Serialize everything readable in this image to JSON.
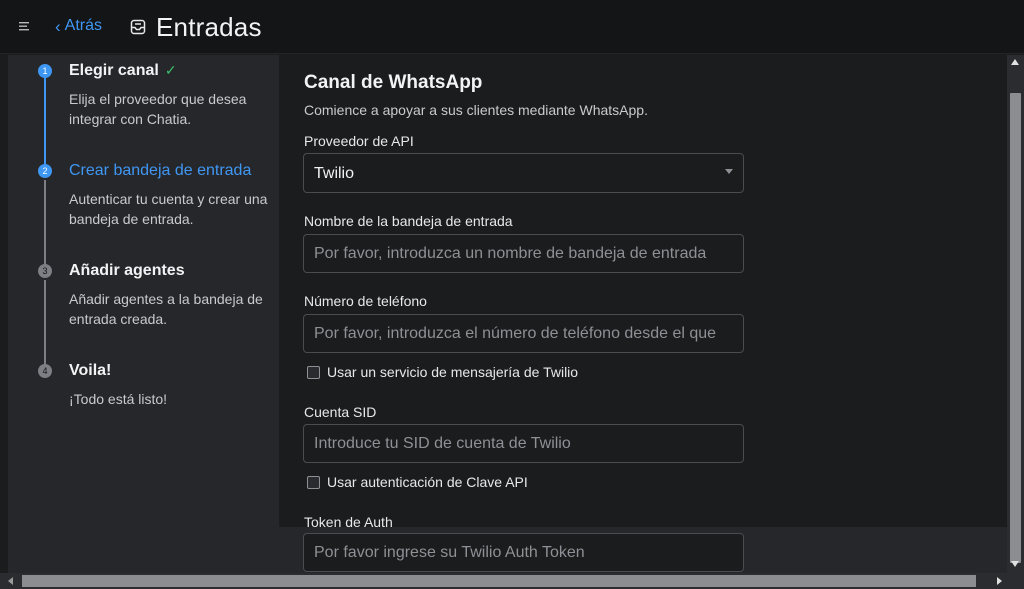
{
  "header": {
    "back_label": "Atrás",
    "title": "Entradas",
    "menu_icon": "hamburger-icon",
    "title_icon": "inbox-icon"
  },
  "steps": [
    {
      "number": "1",
      "title": "Elegir canal",
      "description": "Elija el proveedor que desea integrar con Chatia.",
      "status": "completed"
    },
    {
      "number": "2",
      "title": "Crear bandeja de entrada",
      "description": "Autenticar tu cuenta y crear una bandeja de entrada.",
      "status": "active"
    },
    {
      "number": "3",
      "title": "Añadir agentes",
      "description": "Añadir agentes a la bandeja de entrada creada.",
      "status": "pending"
    },
    {
      "number": "4",
      "title": "Voila!",
      "description": "¡Todo está listo!",
      "status": "pending"
    }
  ],
  "form": {
    "title": "Canal de WhatsApp",
    "subtitle": "Comience a apoyar a sus clientes mediante WhatsApp.",
    "api_provider": {
      "label": "Proveedor de API",
      "value": "Twilio"
    },
    "inbox_name": {
      "label": "Nombre de la bandeja de entrada",
      "placeholder": "Por favor, introduzca un nombre de bandeja de entrada"
    },
    "phone": {
      "label": "Número de teléfono",
      "placeholder": "Por favor, introduzca el número de teléfono desde el que"
    },
    "messaging_service_checkbox": "Usar un servicio de mensajería de Twilio",
    "account_sid": {
      "label": "Cuenta SID",
      "placeholder": "Introduce tu SID de cuenta de Twilio"
    },
    "api_key_checkbox": "Usar autenticación de Clave API",
    "auth_token": {
      "label": "Token de Auth",
      "placeholder": "Por favor ingrese su Twilio Auth Token"
    }
  },
  "colors": {
    "accent": "#3f97f4",
    "success": "#3bbd6a",
    "background": "#1b1c1e",
    "panel": "#26272a"
  }
}
